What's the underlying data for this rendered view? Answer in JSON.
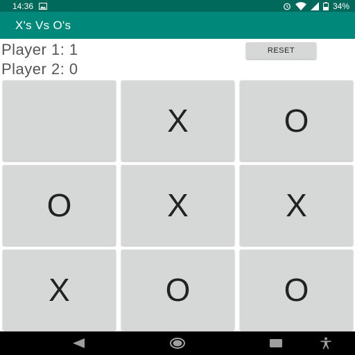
{
  "status_bar": {
    "time": "14:36",
    "battery": "34%",
    "icons": [
      "image-icon",
      "alarm-icon",
      "wifi-icon",
      "signal-icon",
      "battery-icon"
    ]
  },
  "app_bar": {
    "title": "X's Vs O's",
    "color": "#00897b"
  },
  "scores": {
    "player1": "Player 1: 1",
    "player2": "Player 2: 0"
  },
  "controls": {
    "reset_label": "RESET"
  },
  "board": {
    "cells": [
      "",
      "X",
      "O",
      "O",
      "X",
      "X",
      "X",
      "O",
      "O"
    ]
  },
  "nav_bar": {
    "icons": [
      "back-icon",
      "home-icon",
      "recents-icon",
      "accessibility-icon"
    ]
  }
}
